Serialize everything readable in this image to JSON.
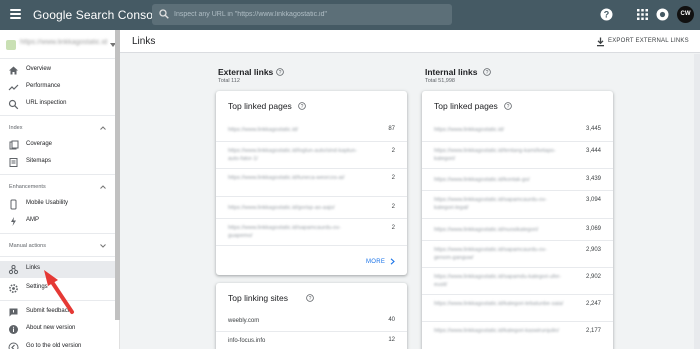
{
  "app": {
    "title": "Google Search Console",
    "search_placeholder": "Inspect any URL in \"https://www.linkkagostatic.id\"",
    "avatar_text": "CW",
    "accent": "#455a64"
  },
  "property": {
    "label": "https://www.linkkagostatic.id"
  },
  "sidebar": {
    "top_items": [
      {
        "label": "Overview",
        "icon": "home-icon"
      },
      {
        "label": "Performance",
        "icon": "trend-icon"
      },
      {
        "label": "URL inspection",
        "icon": "search-icon"
      }
    ],
    "sections": [
      {
        "title": "Index",
        "items": [
          {
            "label": "Coverage",
            "icon": "coverage-icon"
          },
          {
            "label": "Sitemaps",
            "icon": "sitemap-icon"
          }
        ]
      },
      {
        "title": "Enhancements",
        "items": [
          {
            "label": "Mobile Usability",
            "icon": "phone-icon"
          },
          {
            "label": "AMP",
            "icon": "amp-icon"
          }
        ]
      },
      {
        "title": "Manual actions",
        "items": []
      }
    ],
    "bottom_items": [
      {
        "label": "Links",
        "icon": "links-icon",
        "active": true
      },
      {
        "label": "Settings",
        "icon": "gear-icon"
      },
      {
        "label": "Submit feedback",
        "icon": "feedback-icon"
      },
      {
        "label": "About new version",
        "icon": "info-icon"
      },
      {
        "label": "Go to the old version",
        "icon": "back-icon"
      }
    ]
  },
  "header": {
    "title": "Links",
    "export_label": "EXPORT EXTERNAL LINKS"
  },
  "external": {
    "heading": "External links",
    "total": "Total 112",
    "top_linked_pages": {
      "title": "Top linked pages",
      "rows": [
        {
          "url": "https://www.linkkagostatic.id/",
          "value": "87"
        },
        {
          "url": "https://www.linkkagostatic.id/loglun-auto/sind-kaptun-auto-fator-1/",
          "value": "2"
        },
        {
          "url": "https://www.linkkagostatic.id/tuneca-weorcos-ai/",
          "value": "2"
        },
        {
          "url": "https://www.linkkagostatic.id/gorisp-ao-aajo/",
          "value": "2"
        },
        {
          "url": "https://www.linkkagostatic.id/sapamcaurdu-ov-guapemo/",
          "value": "2"
        }
      ],
      "more": "MORE"
    },
    "top_linking_sites": {
      "title": "Top linking sites",
      "rows": [
        {
          "url": "weebly.com",
          "value": "40"
        },
        {
          "url": "info-focus.info",
          "value": "12"
        }
      ]
    }
  },
  "internal": {
    "heading": "Internal links",
    "total": "Total 51,998",
    "top_linked_pages": {
      "title": "Top linked pages",
      "rows": [
        {
          "url": "https://www.linkkagostatic.id/",
          "value": "3,445"
        },
        {
          "url": "https://www.linkkagostatic.id/tentang-kami/ketapo-kategori/",
          "value": "3,444"
        },
        {
          "url": "https://www.linkkagostatic.id/kontak-go/",
          "value": "3,439"
        },
        {
          "url": "https://www.linkkagostatic.id/sapamcaurdu-ov-kategori-legal/",
          "value": "3,094"
        },
        {
          "url": "https://www.linkkagostatic.id/nuosikategori/",
          "value": "3,069"
        },
        {
          "url": "https://www.linkkagostatic.id/sapamcaurdu-ov-genom-ganguw/",
          "value": "2,903"
        },
        {
          "url": "https://www.linkkagostatic.id/sapamdu-kategori-ufer-eusit/",
          "value": "2,902"
        },
        {
          "url": "https://www.linkkagostatic.id/kategori-tebatunbe-saia/",
          "value": "2,247"
        },
        {
          "url": "https://www.linkkagostatic.id/kategori-kaswirurqulin/",
          "value": "2,177"
        }
      ]
    }
  }
}
